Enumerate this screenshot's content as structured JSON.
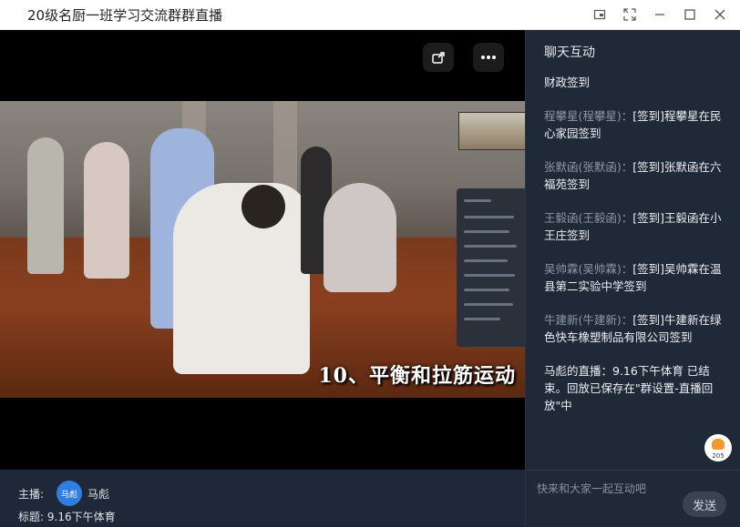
{
  "window": {
    "title": "20级名厨一班学习交流群群直播",
    "controls": [
      "pin-icon",
      "fullscreen-icon",
      "minimize-icon",
      "maximize-icon",
      "close-icon"
    ]
  },
  "video": {
    "caption": "10、平衡和拉筋运动",
    "top_buttons": [
      "share-icon",
      "more-icon"
    ]
  },
  "host": {
    "label": "主播:",
    "avatar_text": "马彪",
    "name": "马彪",
    "subject_label": "标题:",
    "subject": "9.16下午体育"
  },
  "chat": {
    "title": "聊天互动",
    "messages": [
      {
        "sender": "",
        "sep": "",
        "text": "财政签到"
      },
      {
        "sender": "程攀星(程攀星)",
        "sep": "：",
        "text": "[签到]程攀星在民心家园签到"
      },
      {
        "sender": "张默函(张默函)",
        "sep": "：",
        "text": "[签到]张默函在六福苑签到"
      },
      {
        "sender": "王毅函(王毅函)",
        "sep": "：",
        "text": "[签到]王毅函在小王庄签到"
      },
      {
        "sender": "吴帅霖(吴帅霖)",
        "sep": "：",
        "text": "[签到]吴帅霖在温县第二实验中学签到"
      },
      {
        "sender": "牛建新(牛建新)",
        "sep": "：",
        "text": "[签到]牛建新在绿色快车橡塑制品有限公司签到"
      },
      {
        "sender": "",
        "sep": "",
        "text": "马彪的直播：9.16下午体育 已结束。回放已保存在\"群设置-直播回放\"中"
      }
    ],
    "like_count": "205",
    "input_placeholder": "快来和大家一起互动吧",
    "send_label": "发送"
  }
}
